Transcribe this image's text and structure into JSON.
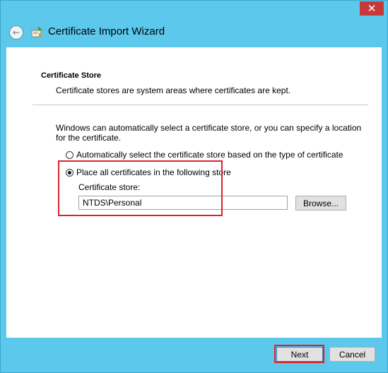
{
  "window": {
    "close_symbol": "✕",
    "back_symbol": "←"
  },
  "wizard": {
    "title": "Certificate Import Wizard"
  },
  "section": {
    "title": "Certificate Store",
    "description": "Certificate stores are system areas where certificates are kept."
  },
  "info_text": "Windows can automatically select a certificate store, or you can specify a location for the certificate.",
  "options": {
    "auto_label": "Automatically select the certificate store based on the type of certificate",
    "auto_selected": false,
    "manual_label": "Place all certificates in the following store",
    "manual_selected": true
  },
  "store": {
    "label": "Certificate store:",
    "value": "NTDS\\Personal",
    "browse_label": "Browse..."
  },
  "footer": {
    "next_label": "Next",
    "cancel_label": "Cancel"
  },
  "colors": {
    "frame": "#5cc8ec",
    "close_button": "#c7383a",
    "highlight": "#d9232d"
  }
}
